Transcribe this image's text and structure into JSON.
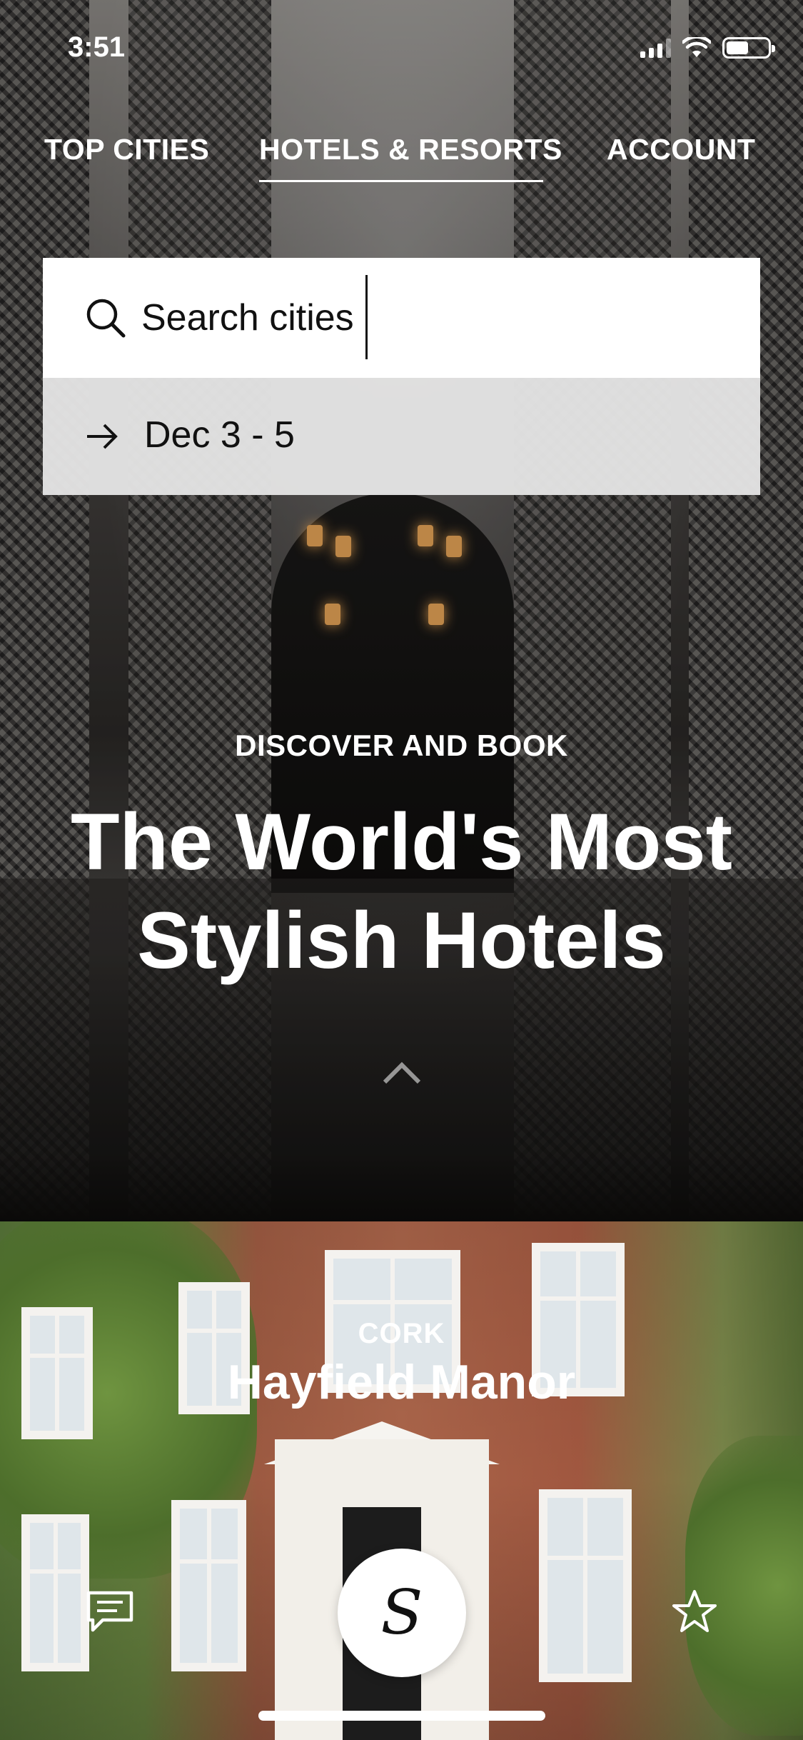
{
  "status_bar": {
    "time": "3:51"
  },
  "tabs": [
    {
      "label": "TOP CITIES"
    },
    {
      "label": "HOTELS & RESORTS",
      "active": true
    },
    {
      "label": "ACCOUNT"
    }
  ],
  "search": {
    "value": "Search cities",
    "icon": "search-icon"
  },
  "dates": {
    "label": "Dec 3 - 5",
    "icon": "arrow-right-icon"
  },
  "hero": {
    "eyebrow": "DISCOVER AND BOOK",
    "headline_line1": "The World's Most",
    "headline_line2": "Stylish Hotels"
  },
  "featured_hotel": {
    "city": "CORK",
    "name": "Hayfield Manor"
  },
  "bottom_bar": {
    "left_icon": "chat-icon",
    "center_logo": "S",
    "right_icon": "star-icon"
  },
  "colors": {
    "text_light": "#ffffff",
    "text_dark": "#111111",
    "search_bg": "#ffffff",
    "date_row_bg": "#e4e4e4"
  }
}
